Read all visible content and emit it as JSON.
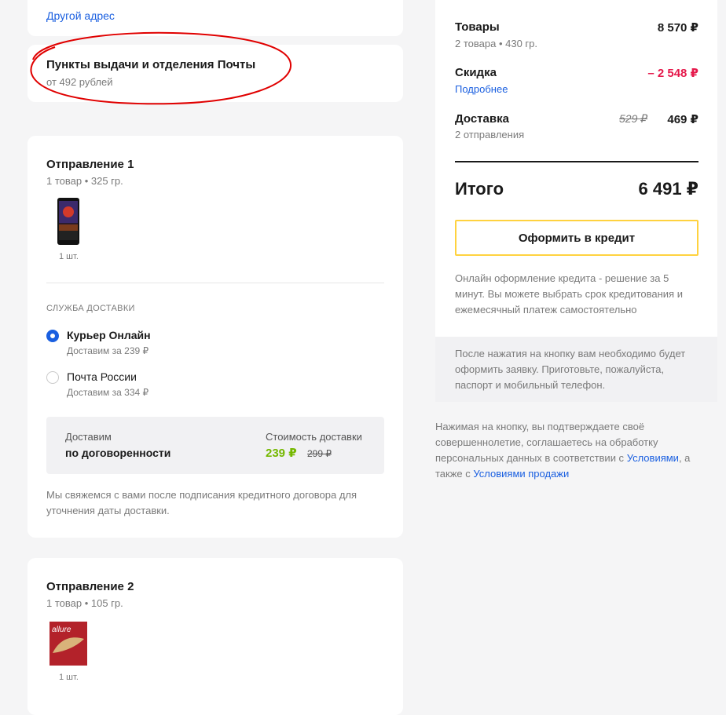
{
  "address": {
    "other_address_link": "Другой адрес"
  },
  "pickup": {
    "title": "Пункты выдачи и отделения Почты",
    "price": "от 492 рублей"
  },
  "shipment1": {
    "title": "Отправление 1",
    "meta": "1 товар • 325 гр.",
    "item_qty": "1 шт.",
    "delivery_service_label": "СЛУЖБА ДОСТАВКИ",
    "options": [
      {
        "name": "Курьер Онлайн",
        "sub": "Доставим за 239 ₽",
        "selected": true
      },
      {
        "name": "Почта России",
        "sub": "Доставим за 334 ₽",
        "selected": false
      }
    ],
    "box": {
      "deliver_label": "Доставим",
      "deliver_value": "по договоренности",
      "cost_label": "Стоимость доставки",
      "cost_new": "239 ₽",
      "cost_old": "299 ₽"
    },
    "note": "Мы свяжемся с вами после подписания кредитного договора для уточнения даты доставки."
  },
  "shipment2": {
    "title": "Отправление 2",
    "meta": "1 товар • 105 гр.",
    "item_qty": "1 шт.",
    "product_brand_text": "allure"
  },
  "summary": {
    "goods_label": "Товары",
    "goods_sub": "2 товара • 430 гр.",
    "goods_value": "8 570 ₽",
    "discount_label": "Скидка",
    "discount_link": "Подробнее",
    "discount_value": "– 2 548 ₽",
    "shipping_label": "Доставка",
    "shipping_sub": "2 отправления",
    "shipping_old": "529 ₽",
    "shipping_new": "469 ₽",
    "total_label": "Итого",
    "total_value": "6 491 ₽",
    "credit_button": "Оформить в кредит",
    "credit_info": "Онлайн оформление кредита - решение за 5 минут. Вы можете выбрать срок кредитования и ежемесячный платеж самостоятельно",
    "after_click_note": "После нажатия на кнопку вам необходимо будет оформить заявку. Приготовьте, пожалуйста, паспорт и мобильный телефон."
  },
  "consent": {
    "part1": "Нажимая на кнопку, вы подтверждаете своё совершеннолетие, соглашаетесь на обработку персональных данных в соответствии с",
    "link1": "Условиями",
    "part2": ", а также с",
    "link2": "Условиями продажи"
  },
  "colors": {
    "accent_blue": "#1a5fe0",
    "discount_red": "#e5194b",
    "price_green": "#75b800",
    "button_border": "#ffd23f",
    "annotation_red": "#e00000"
  }
}
